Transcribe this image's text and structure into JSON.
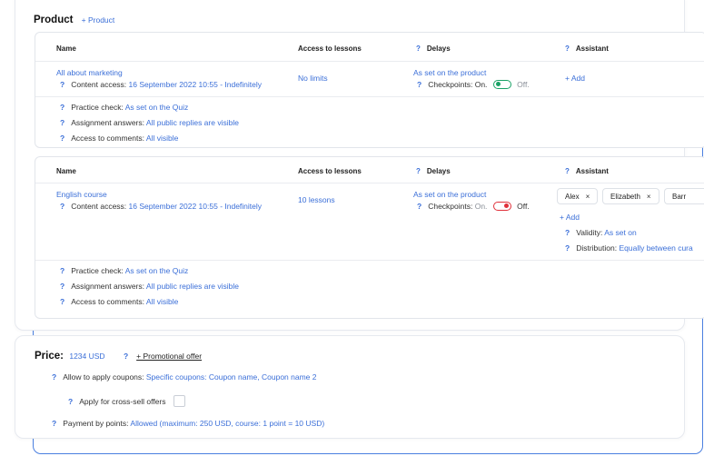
{
  "product_section": {
    "title": "Product",
    "add_label": "+ Product"
  },
  "columns": {
    "name": "Name",
    "access": "Access to lessons",
    "delays": "Delays",
    "assistant": "Assistant"
  },
  "product1": {
    "name": "All about marketing",
    "content_access_label": "Content access:",
    "content_access_value": "16 September 2022 10:55 - Indefinitely",
    "access": "No limits",
    "delays_value": "As set on the product",
    "checkpoints_label": "Checkpoints:",
    "on_label": "On.",
    "off_label": "Off.",
    "assistant_add": "+ Add",
    "practice_label": "Practice check:",
    "practice_value": "As set on the Quiz",
    "answers_label": "Assignment answers:",
    "answers_value": "All public replies are visible",
    "comments_label": "Access to comments:",
    "comments_value": "All visible",
    "toggle_state": "on"
  },
  "product2": {
    "name": "English course",
    "content_access_label": "Content access:",
    "content_access_value": "16 September 2022 10:55 - Indefinitely",
    "access": "10 lessons",
    "delays_value": "As set on the product",
    "checkpoints_label": "Checkpoints:",
    "on_label": "On.",
    "off_label": "Off.",
    "assistants": [
      "Alex",
      "Elizabeth",
      "Barr"
    ],
    "assistant_add": "+ Add",
    "validity_label": "Validity:",
    "validity_value": "As set on",
    "distribution_label": "Distribution:",
    "distribution_value": "Equally between cura",
    "practice_label": "Practice check:",
    "practice_value": "As set on the Quiz",
    "answers_label": "Assignment answers:",
    "answers_value": "All public replies are visible",
    "comments_label": "Access to comments:",
    "comments_value": "All visible",
    "toggle_state": "off"
  },
  "price": {
    "label": "Price:",
    "value": "1234 USD",
    "promo": "+ Promotional offer",
    "coupons_label": "Allow to apply coupons:",
    "coupons_value": "Specific coupons: Coupon name, Coupon name 2",
    "crosssell_label": "Apply for cross-sell offers",
    "points_label": "Payment by points:",
    "points_value": "Allowed (maximum: 250 USD, course: 1 point = 10 USD)"
  },
  "icons": {
    "help": "?",
    "remove": "×"
  },
  "colors": {
    "link": "#3b6fd8",
    "toggle_on": "#1aa266",
    "toggle_off": "#e0303a",
    "frame": "#4a7fe0"
  }
}
